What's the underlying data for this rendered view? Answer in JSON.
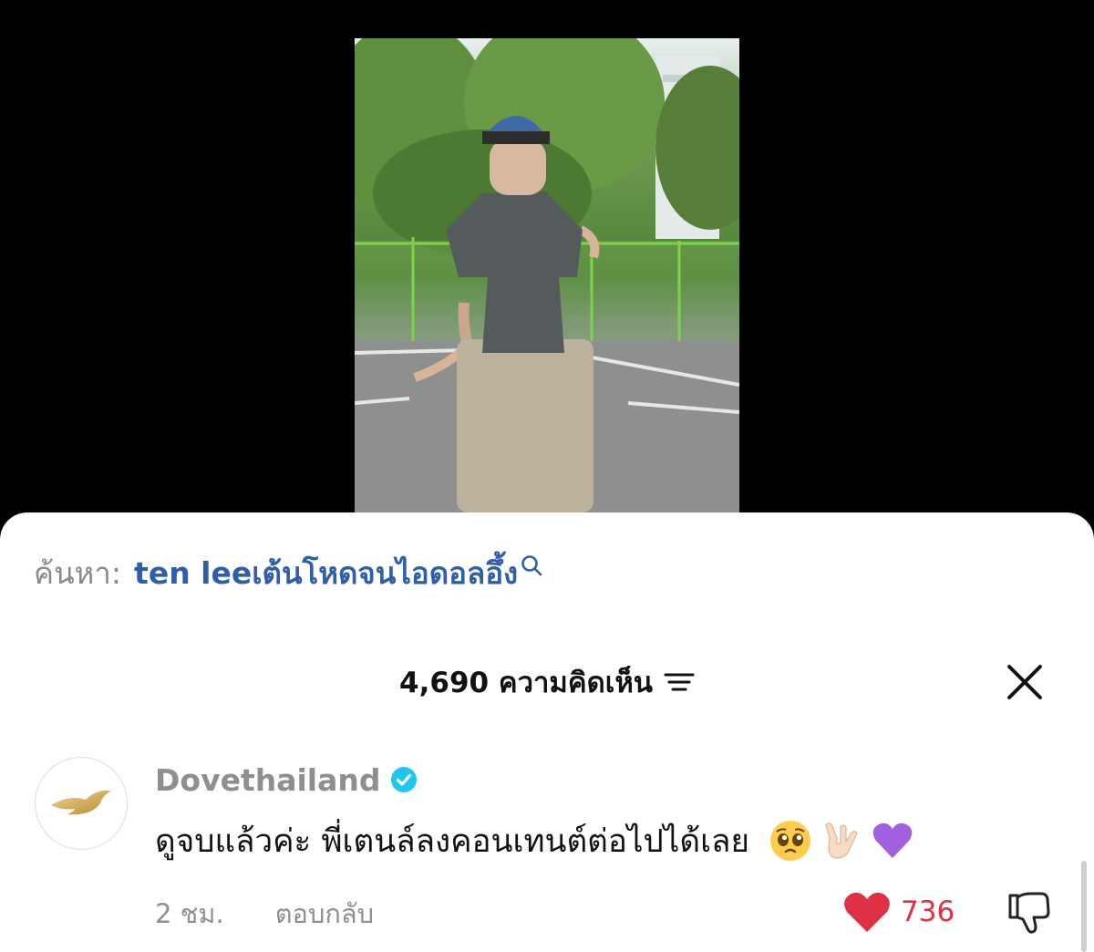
{
  "search": {
    "prefix": "ค้นหา:",
    "query": "ten leeเต้นโหดจนไอดอลอึ้ง"
  },
  "comments_header": {
    "count_label": "4,690 ความคิดเห็น"
  },
  "comment": {
    "username": "Dovethailand",
    "verified": true,
    "text": "ดูจบแล้วค่ะ พี่เตนล์ลงคอนเทนต์ต่อไปได้เลย",
    "emojis": [
      "pleading-face-emoji",
      "love-you-gesture-emoji",
      "purple-heart-emoji"
    ],
    "time": "2 ชม.",
    "reply_label": "ตอบกลับ",
    "likes": "736",
    "liked": true
  },
  "colors": {
    "link_blue": "#2f5fa8",
    "like_red": "#de3145",
    "verified_blue": "#20c5f0",
    "muted_gray": "#8f8f8f"
  }
}
